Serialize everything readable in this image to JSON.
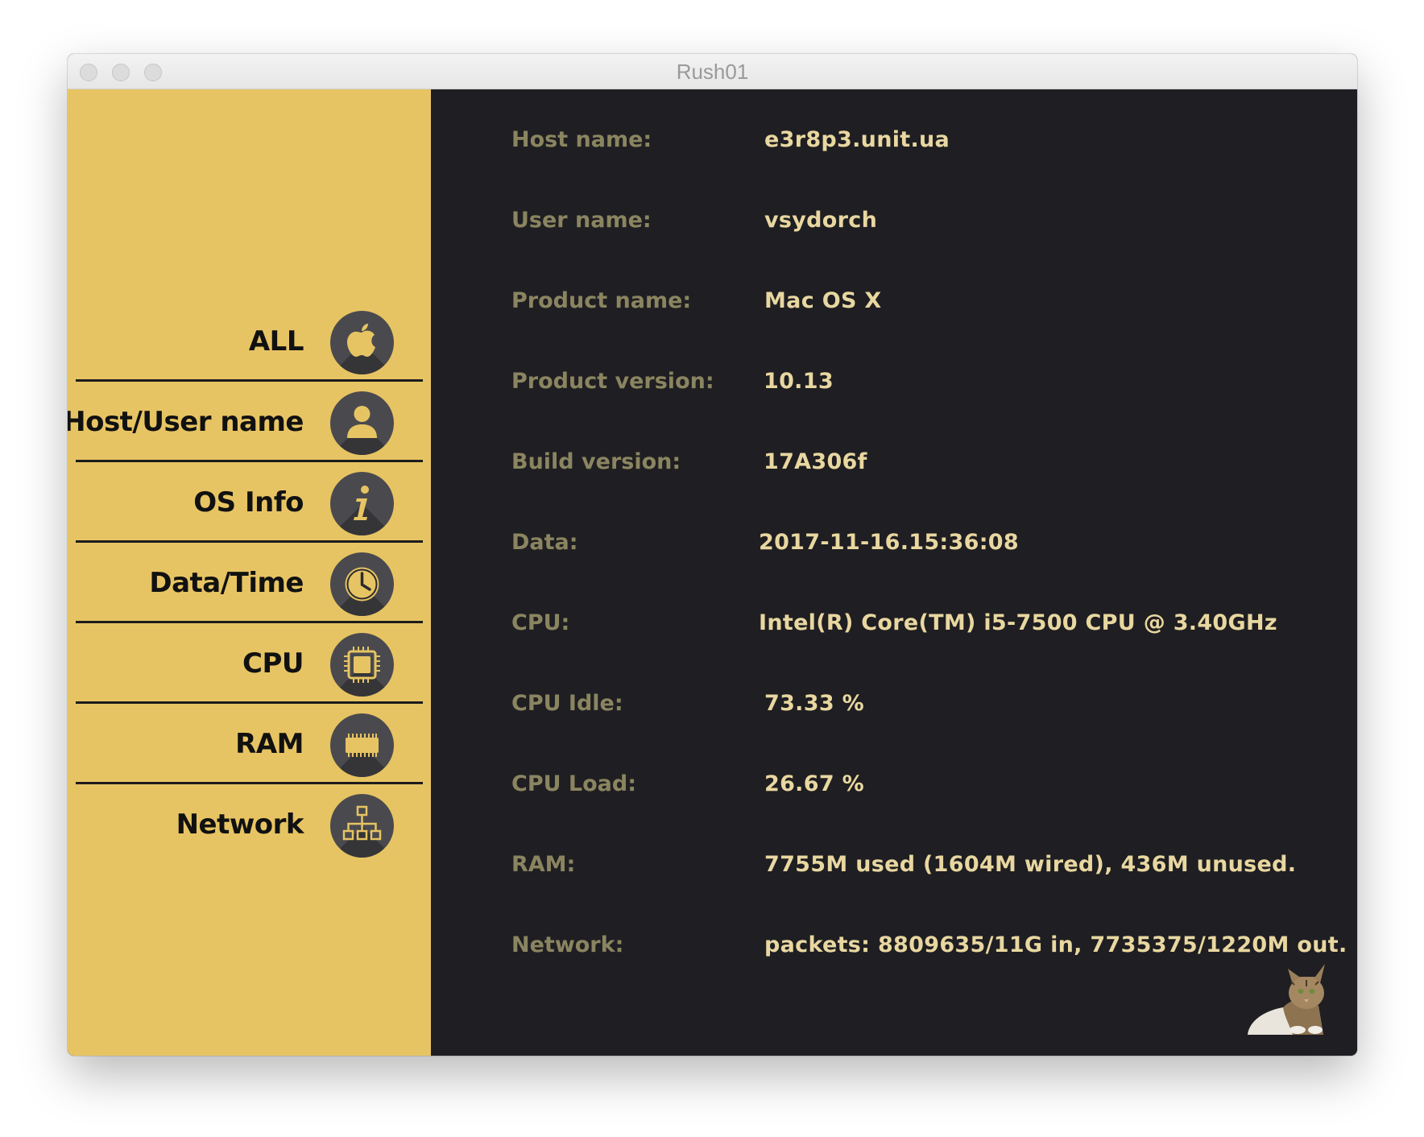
{
  "window": {
    "title": "Rush01"
  },
  "sidebar": {
    "items": [
      {
        "label": "ALL",
        "icon": "apple-icon"
      },
      {
        "label": "Host/User name",
        "icon": "user-icon"
      },
      {
        "label": "OS Info",
        "icon": "info-icon"
      },
      {
        "label": "Data/Time",
        "icon": "clock-icon"
      },
      {
        "label": "CPU",
        "icon": "cpu-chip-icon"
      },
      {
        "label": "RAM",
        "icon": "ram-chip-icon"
      },
      {
        "label": "Network",
        "icon": "network-icon"
      }
    ]
  },
  "info": {
    "rows": [
      {
        "label": "Host name:",
        "value": "e3r8p3.unit.ua"
      },
      {
        "label": "User name:",
        "value": "vsydorch"
      },
      {
        "label": "Product name:",
        "value": "Mac OS X"
      },
      {
        "label": "Product version:",
        "value": "10.13"
      },
      {
        "label": "Build version:",
        "value": "17A306f"
      },
      {
        "label": "Data:",
        "value": "2017-11-16.15:36:08"
      },
      {
        "label": "CPU:",
        "value": "Intel(R) Core(TM) i5-7500 CPU @ 3.40GHz"
      },
      {
        "label": "CPU Idle:",
        "value": "73.33 %"
      },
      {
        "label": "CPU Load:",
        "value": "26.67 %"
      },
      {
        "label": "RAM:",
        "value": "7755M used (1604M wired), 436M unused."
      },
      {
        "label": "Network:",
        "value": "packets: 8809635/11G in, 7735375/1220M out."
      }
    ]
  },
  "colors": {
    "sidebar_bg": "#e7c463",
    "content_bg": "#1f1e22",
    "label_color": "#8a8560",
    "value_color": "#e8d7a0",
    "icon_bg": "#4a4a4e",
    "icon_fg": "#e7c463"
  }
}
